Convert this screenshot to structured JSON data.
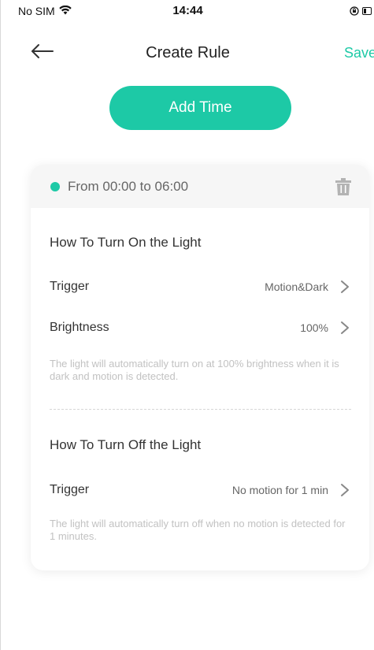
{
  "status_bar": {
    "carrier": "No SIM",
    "time": "14:44",
    "wifi_icon": "wifi-icon",
    "orientation_lock_icon": "orientation-lock-icon",
    "battery_icon": "battery-icon"
  },
  "nav": {
    "back_icon": "back-arrow-icon",
    "title": "Create Rule",
    "save_label": "Save"
  },
  "add_time": {
    "label": "Add Time"
  },
  "rule_card": {
    "time_range": "From 00:00 to 06:00",
    "delete_icon": "trash-icon",
    "turn_on": {
      "title": "How To Turn On the Light",
      "trigger_label": "Trigger",
      "trigger_value": "Motion&Dark",
      "brightness_label": "Brightness",
      "brightness_value": "100%",
      "description": "The light will automatically turn on at 100% brightness when it is dark and motion is detected."
    },
    "turn_off": {
      "title": "How To Turn Off the Light",
      "trigger_label": "Trigger",
      "trigger_value": "No motion for 1 min",
      "description": "The light will automatically turn off when no motion is detected for 1 minutes."
    }
  },
  "colors": {
    "accent": "#1dc9a6",
    "header_bg": "#f6f6f6",
    "muted_text": "#c2c2c2"
  }
}
